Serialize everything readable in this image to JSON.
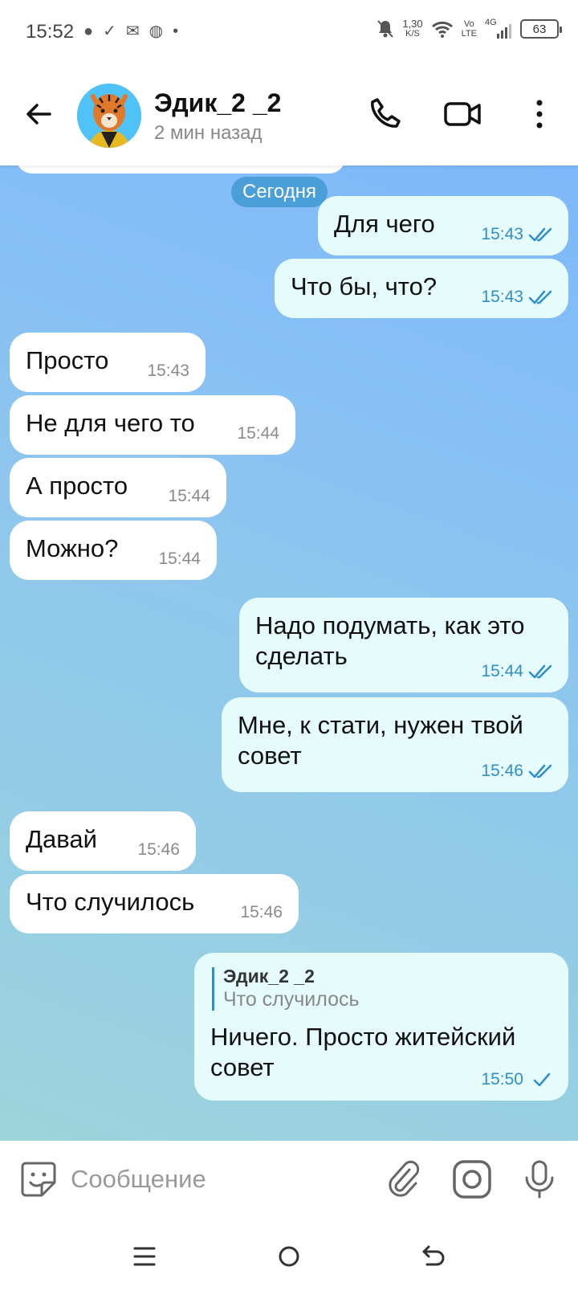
{
  "status_bar": {
    "time": "15:52",
    "net_speed_value": "1,30",
    "net_speed_unit": "K/S",
    "volte_top": "Vo",
    "volte_bottom": "LTE",
    "network": "4G",
    "battery": "63"
  },
  "header": {
    "title": "Эдик_2 _2",
    "status": "2 мин назад"
  },
  "date_chip": "Сегодня",
  "messages": [
    {
      "dir": "out",
      "text": "Для чего",
      "time": "15:43",
      "check": "double"
    },
    {
      "dir": "out",
      "text": "Что бы, что?",
      "time": "15:43",
      "check": "double"
    },
    {
      "dir": "in",
      "text": "Просто",
      "time": "15:43"
    },
    {
      "dir": "in",
      "text": "Не для чего то",
      "time": "15:44"
    },
    {
      "dir": "in",
      "text": "А просто",
      "time": "15:44"
    },
    {
      "dir": "in",
      "text": "Можно?",
      "time": "15:44"
    },
    {
      "dir": "out",
      "text": "Надо подумать, как это сделать",
      "time": "15:44",
      "check": "double"
    },
    {
      "dir": "out",
      "text": "Мне, к стати, нужен твой совет",
      "time": "15:46",
      "check": "double"
    },
    {
      "dir": "in",
      "text": "Давай",
      "time": "15:46"
    },
    {
      "dir": "in",
      "text": "Что случилось",
      "time": "15:46"
    },
    {
      "dir": "out",
      "reply_to_name": "Эдик_2 _2",
      "reply_to_text": "Что случилось",
      "text": "Ничего. Просто житейский совет",
      "time": "15:50",
      "check": "single"
    }
  ],
  "input": {
    "placeholder": "Сообщение"
  },
  "colors": {
    "accent": "#2e8fc9",
    "date_chip": "#4a9fd8",
    "outgoing_bubble": "#e6fbfb",
    "incoming_bubble": "#ffffff"
  },
  "icons": [
    "back-arrow-icon",
    "phone-icon",
    "video-call-icon",
    "more-vert-icon",
    "sticker-icon",
    "attach-icon",
    "camera-icon",
    "mic-icon"
  ]
}
